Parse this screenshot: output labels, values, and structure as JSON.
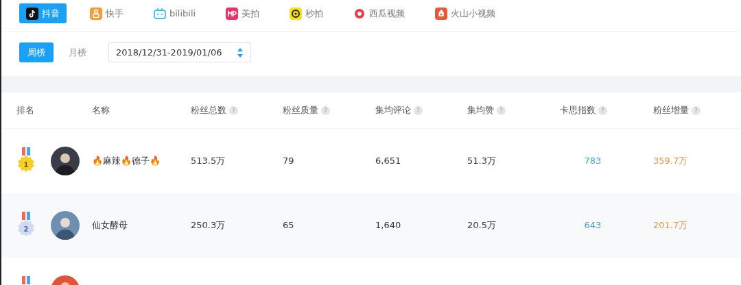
{
  "platform_tabs": [
    {
      "label": "抖音",
      "selected": true
    },
    {
      "label": "快手",
      "selected": false
    },
    {
      "label": "bilibili",
      "selected": false
    },
    {
      "label": "美拍",
      "selected": false
    },
    {
      "label": "秒拍",
      "selected": false
    },
    {
      "label": "西瓜视频",
      "selected": false
    },
    {
      "label": "火山小视频",
      "selected": false
    }
  ],
  "period_tabs": [
    {
      "label": "周榜",
      "selected": true
    },
    {
      "label": "月榜",
      "selected": false
    }
  ],
  "date_range": {
    "value": "2018/12/31-2019/01/06"
  },
  "table": {
    "columns": [
      {
        "label": "排名",
        "help": false
      },
      {
        "label": "名称",
        "help": false
      },
      {
        "label": "粉丝总数",
        "help": true
      },
      {
        "label": "粉丝质量",
        "help": true
      },
      {
        "label": "集均评论",
        "help": true
      },
      {
        "label": "集均赞",
        "help": true
      },
      {
        "label": "卡思指数",
        "help": true
      },
      {
        "label": "粉丝增量",
        "help": true
      }
    ],
    "help_mark": "?",
    "rows": [
      {
        "rank": "1",
        "name": "🔥麻辣🔥德子🔥",
        "fans": "513.5万",
        "quality": "79",
        "comments": "6,651",
        "likes": "51.3万",
        "index": "783",
        "growth": "359.7万"
      },
      {
        "rank": "2",
        "name": "仙女酵母",
        "fans": "250.3万",
        "quality": "65",
        "comments": "1,640",
        "likes": "20.5万",
        "index": "643",
        "growth": "201.7万"
      },
      {}
    ]
  }
}
